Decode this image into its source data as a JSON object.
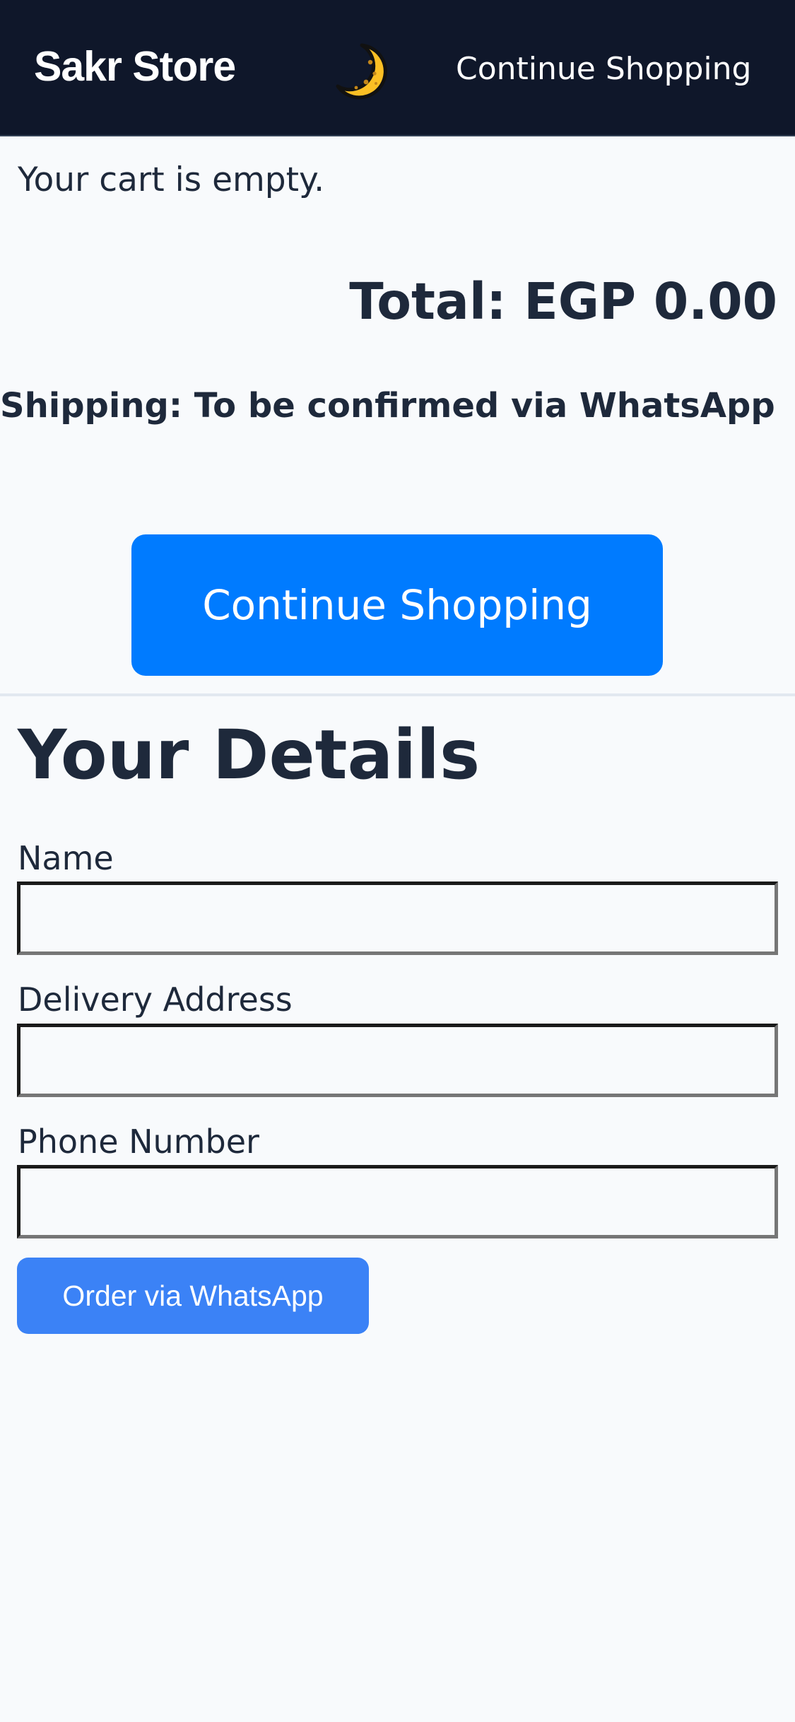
{
  "header": {
    "brand": "Sakr Store",
    "theme_icon": "crescent-moon-icon",
    "continue_link": "Continue Shopping"
  },
  "cart": {
    "empty_message": "Your cart is empty.",
    "total": "Total: EGP 0.00",
    "shipping": "Shipping: To be confirmed via WhatsApp",
    "continue_button": "Continue Shopping"
  },
  "details": {
    "title": "Your Details",
    "name_label": "Name",
    "name_value": "",
    "address_label": "Delivery Address",
    "address_value": "",
    "phone_label": "Phone Number",
    "phone_value": "",
    "order_button": "Order via WhatsApp"
  },
  "colors": {
    "header_bg": "#0f172a",
    "page_bg": "#f8fafc",
    "primary_button": "#007bff",
    "order_button": "#3b82f6",
    "moon": "#fbbf24"
  }
}
